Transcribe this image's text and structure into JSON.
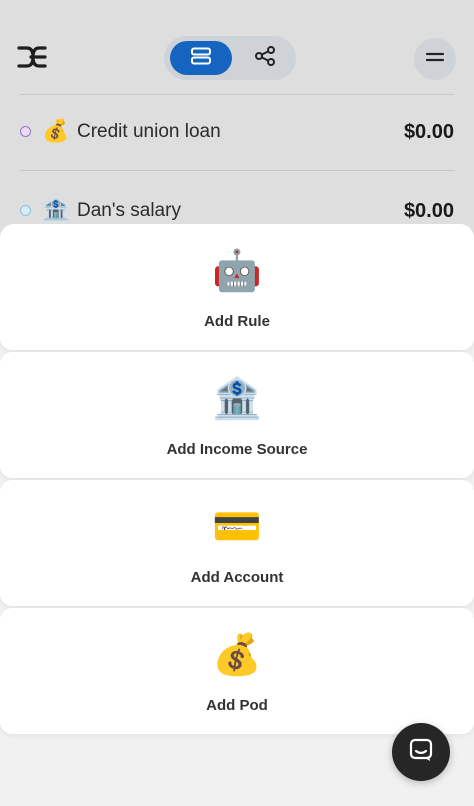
{
  "header": {
    "logo_icon": "ohm-logo-icon",
    "view_toggle": {
      "list_icon": "list-view-icon",
      "graph_icon": "graph-view-icon",
      "active": "list",
      "active_color": "#1565c0"
    },
    "menu_icon": "hamburger-menu-icon"
  },
  "rows": [
    {
      "emoji": "💰",
      "label": "Credit union loan",
      "amount": "$0.00",
      "dot_color": "#c9a7e0"
    },
    {
      "emoji": "🏦",
      "label": "Dan's salary",
      "amount": "$0.00",
      "dot_color": "#b7dbee"
    }
  ],
  "sheet": {
    "actions": [
      {
        "icon": "🤖",
        "label": "Add Rule"
      },
      {
        "icon": "🏦",
        "label": "Add Income Source"
      },
      {
        "icon": "💳",
        "label": "Add Account"
      },
      {
        "icon": "💰",
        "label": "Add Pod"
      }
    ]
  },
  "chat_icon": "chat-bubble-icon"
}
